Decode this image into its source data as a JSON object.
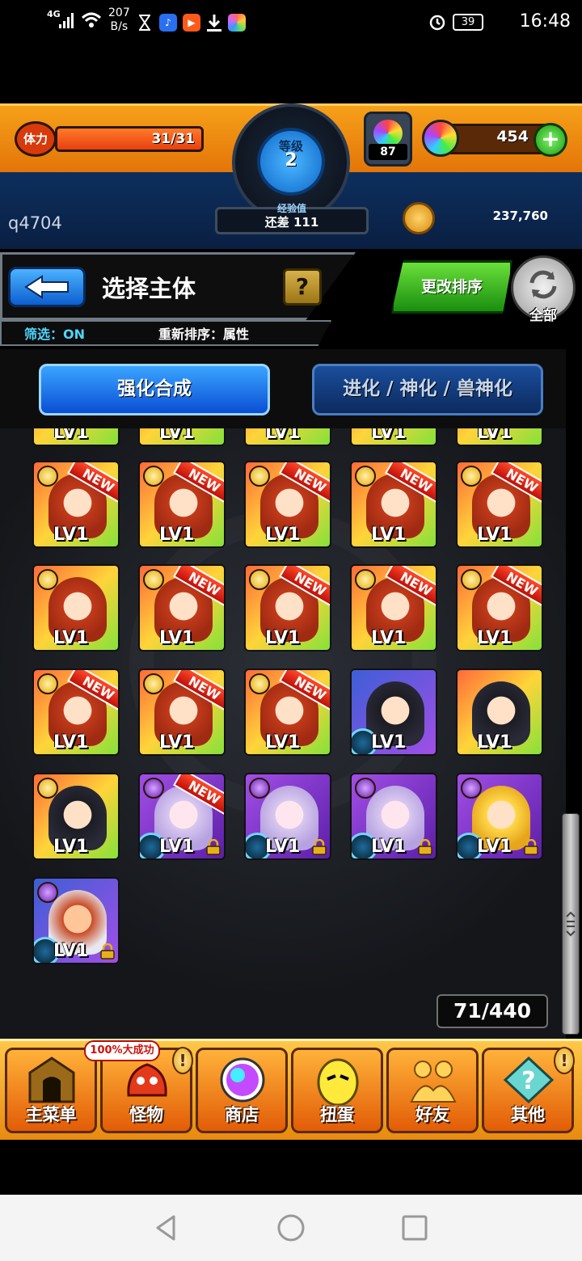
{
  "status_bar": {
    "network": "4G",
    "speed_value": "207",
    "speed_unit": "B/s",
    "battery": "39",
    "time": "16:48",
    "icons": [
      "signal-icon",
      "wifi-icon",
      "hourglass-icon",
      "music-app-icon",
      "video-app-icon",
      "download-icon",
      "photos-app-icon",
      "alarm-icon",
      "battery-icon"
    ]
  },
  "hud": {
    "stamina_label": "体力",
    "stamina": "31/31",
    "stamina_fraction": 1.0,
    "level_label": "等级",
    "level": "2",
    "exp_label": "经验值",
    "exp_remaining": "还差 111",
    "potion_count": "87",
    "stones": "454",
    "username": "q4704",
    "gold": "237,760"
  },
  "header": {
    "title": "选择主体",
    "help": "?",
    "filter": "筛选：ON",
    "sort_status": "重新排序：属性",
    "change_sort": "更改排序",
    "all_label": "全部"
  },
  "tabs": [
    {
      "label": "强化合成",
      "active": true
    },
    {
      "label": "进化 / 神化 / 兽神化",
      "active": false
    }
  ],
  "monster_grid": {
    "level_label": "LV1",
    "new_label": "NEW",
    "count": "71/440",
    "rows": [
      [
        {
          "art": "red",
          "frame": "gold",
          "elem": "light",
          "new": true,
          "orb": false,
          "lock": false
        },
        {
          "art": "red",
          "frame": "gold",
          "elem": "light",
          "new": true,
          "orb": false,
          "lock": false
        },
        {
          "art": "red",
          "frame": "gold",
          "elem": "light",
          "new": true,
          "orb": false,
          "lock": false
        },
        {
          "art": "red",
          "frame": "gold",
          "elem": "light",
          "new": true,
          "orb": false,
          "lock": false
        },
        {
          "art": "red",
          "frame": "gold",
          "elem": "light",
          "new": true,
          "orb": false,
          "lock": false
        }
      ],
      [
        {
          "art": "red",
          "frame": "gold",
          "elem": "light",
          "new": false,
          "orb": false,
          "lock": false
        },
        {
          "art": "red",
          "frame": "gold",
          "elem": "light",
          "new": true,
          "orb": false,
          "lock": false
        },
        {
          "art": "red",
          "frame": "gold",
          "elem": "light",
          "new": true,
          "orb": false,
          "lock": false
        },
        {
          "art": "red",
          "frame": "gold",
          "elem": "light",
          "new": true,
          "orb": false,
          "lock": false
        },
        {
          "art": "red",
          "frame": "gold",
          "elem": "light",
          "new": true,
          "orb": false,
          "lock": false
        }
      ],
      [
        {
          "art": "red",
          "frame": "gold",
          "elem": "light",
          "new": true,
          "orb": false,
          "lock": false
        },
        {
          "art": "red",
          "frame": "gold",
          "elem": "light",
          "new": true,
          "orb": false,
          "lock": false
        },
        {
          "art": "red",
          "frame": "gold",
          "elem": "light",
          "new": true,
          "orb": false,
          "lock": false
        },
        {
          "art": "dark",
          "frame": "blue",
          "elem": "none",
          "new": false,
          "orb": true,
          "lock": false
        },
        {
          "art": "dark",
          "frame": "gold",
          "elem": "none",
          "new": false,
          "orb": false,
          "lock": false
        }
      ],
      [
        {
          "art": "dark",
          "frame": "gold",
          "elem": "light",
          "new": false,
          "orb": false,
          "lock": false
        },
        {
          "art": "lilac",
          "frame": "purple",
          "elem": "dark",
          "new": true,
          "orb": true,
          "lock": true
        },
        {
          "art": "lilac",
          "frame": "purple",
          "elem": "dark",
          "new": false,
          "orb": true,
          "lock": true
        },
        {
          "art": "lilac",
          "frame": "purple",
          "elem": "dark",
          "new": false,
          "orb": true,
          "lock": true
        },
        {
          "art": "blonde",
          "frame": "purple",
          "elem": "dark",
          "new": false,
          "orb": true,
          "lock": true
        }
      ],
      [
        {
          "art": "mixed",
          "frame": "blue",
          "elem": "dark",
          "new": false,
          "orb": true,
          "lock": true
        }
      ]
    ]
  },
  "bottom_menu": [
    {
      "label": "主菜单",
      "icon": "temple-gate-icon",
      "alert": false
    },
    {
      "label": "怪物",
      "icon": "monster-icon",
      "alert": true,
      "promo": "100%大成功"
    },
    {
      "label": "商店",
      "icon": "rainbow-stone-icon",
      "alert": false
    },
    {
      "label": "扭蛋",
      "icon": "egg-icon",
      "alert": false
    },
    {
      "label": "好友",
      "icon": "friends-icon",
      "alert": false
    },
    {
      "label": "其他",
      "icon": "question-diamond-icon",
      "alert": true
    }
  ],
  "nav": {
    "buttons": [
      "back-nav-icon",
      "home-nav-icon",
      "recents-nav-icon"
    ]
  }
}
